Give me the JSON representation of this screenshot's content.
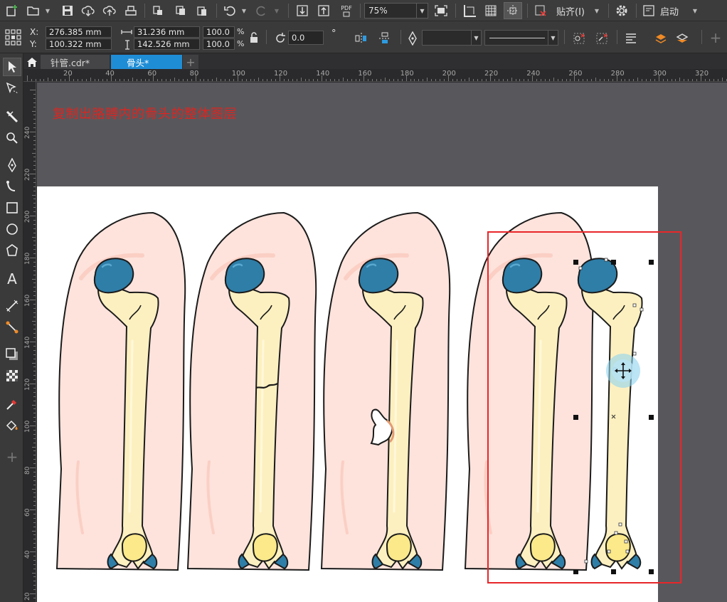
{
  "toolbar": {
    "zoom_value": "75%",
    "snap_label": "贴齐(I)",
    "launch_label": "启动",
    "pdf_label": "PDF",
    "icons": [
      "new-document-icon",
      "open-folder-icon",
      "save-icon",
      "cloud-download-icon",
      "cloud-upload-icon",
      "print-icon",
      "cut-icon",
      "copy-icon",
      "paste-icon",
      "undo-icon",
      "redo-icon",
      "import-icon",
      "export-icon",
      "publish-pdf-icon",
      "full-screen-icon",
      "rulers-icon",
      "grid-icon",
      "guidelines-icon",
      "snap-off-icon",
      "settings-gear-icon",
      "launch-icon"
    ]
  },
  "property_bar": {
    "x_label": "X:",
    "y_label": "Y:",
    "x_value": "276.385 mm",
    "y_value": "100.322 mm",
    "width_value": "31.236 mm",
    "height_value": "142.526 mm",
    "scale_x_value": "100.0",
    "scale_y_value": "100.0",
    "percent_symbol": "%",
    "rotation_value": "0.0",
    "degree_symbol": "°"
  },
  "tabs": [
    {
      "label": "针管.cdr*",
      "active": false
    },
    {
      "label": "骨头*",
      "active": true
    }
  ],
  "ruler": {
    "top_ticks": [
      "20",
      "40",
      "60",
      "80",
      "100",
      "120",
      "140",
      "160",
      "180",
      "200",
      "220",
      "240",
      "260",
      "280",
      "300",
      "320"
    ],
    "left_ticks": [
      "240",
      "220",
      "200",
      "180",
      "160",
      "140",
      "120",
      "100",
      "80",
      "60",
      "40",
      "20"
    ]
  },
  "canvas": {
    "annotation_text": "复制出胳膊内的骨头的整体图层"
  },
  "tools": [
    "pick-tool-icon",
    "shape-tool-icon",
    "crop-tool-icon",
    "zoom-tool-icon",
    "freehand-tool-icon",
    "artistic-media-tool-icon",
    "rectangle-tool-icon",
    "ellipse-tool-icon",
    "polygon-tool-icon",
    "text-tool-icon",
    "parallel-dimension-tool-icon",
    "connector-tool-icon",
    "drop-shadow-tool-icon",
    "transparency-tool-icon",
    "eyedropper-tool-icon",
    "interactive-fill-tool-icon",
    "add-tool-icon"
  ],
  "colors": {
    "skin": "#fde3dc",
    "skin_highlight": "#fbd0c6",
    "bone": "#fdf0c0",
    "bone_end": "#fbe98a",
    "bone_head": "#2e7ea8",
    "outline": "#1b1b1b",
    "annotation": "#e0231f",
    "selection_frame": "#e8262a",
    "active_tab": "#1f8dd6"
  }
}
